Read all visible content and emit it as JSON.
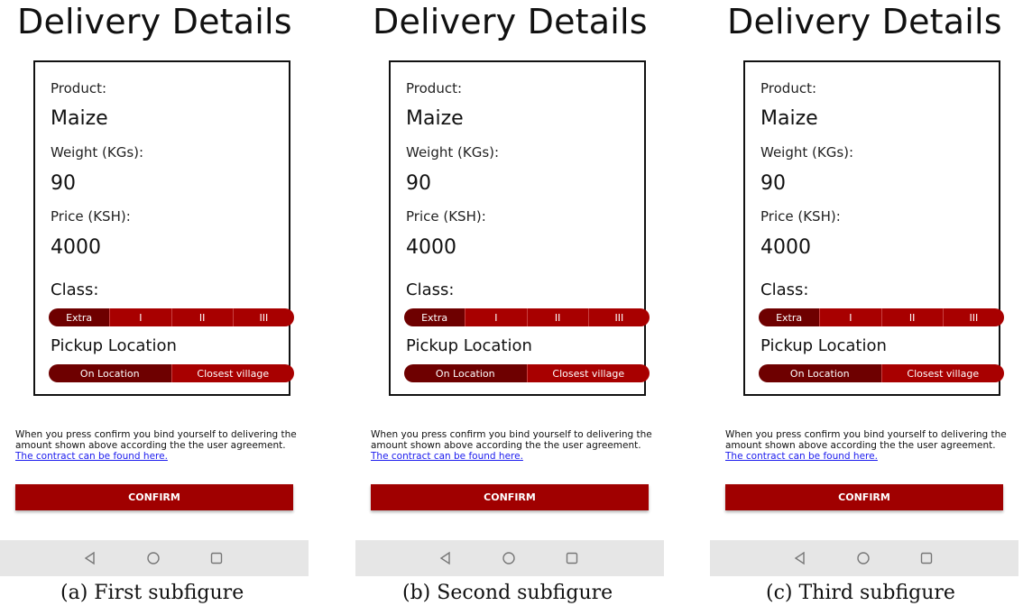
{
  "screens": [
    {
      "title": "Delivery Details",
      "product_label": "Product:",
      "product_value": "Maize",
      "weight_label": "Weight (KGs):",
      "weight_value": "90",
      "price_label": "Price (KSH):",
      "price_value": "4000",
      "class_label": "Class:",
      "class_options": [
        "Extra",
        "I",
        "II",
        "III"
      ],
      "class_selected": "Extra",
      "pickup_label": "Pickup Location",
      "pickup_options": [
        "On Location",
        "Closest village"
      ],
      "pickup_selected": "On Location",
      "notice": "When you press confirm you bind yourself to delivering the amount shown above according the the user agreement.",
      "contract_link": "The contract can be found here.",
      "confirm_label": "CONFIRM",
      "caption": "(a) First subfigure"
    },
    {
      "title": "Delivery Details",
      "product_label": "Product:",
      "product_value": "Maize",
      "weight_label": "Weight (KGs):",
      "weight_value": "90",
      "price_label": "Price (KSH):",
      "price_value": "4000",
      "class_label": "Class:",
      "class_options": [
        "Extra",
        "I",
        "II",
        "III"
      ],
      "class_selected": "Extra",
      "pickup_label": "Pickup Location",
      "pickup_options": [
        "On Location",
        "Closest village"
      ],
      "pickup_selected": "On Location",
      "notice": "When you press confirm you bind yourself to delivering the amount shown above according the the user agreement.",
      "contract_link": "The contract can be found here.",
      "confirm_label": "CONFIRM",
      "caption": "(b) Second subfigure"
    },
    {
      "title": "Delivery Details",
      "product_label": "Product:",
      "product_value": "Maize",
      "weight_label": "Weight (KGs):",
      "weight_value": "90",
      "price_label": "Price (KSH):",
      "price_value": "4000",
      "class_label": "Class:",
      "class_options": [
        "Extra",
        "I",
        "II",
        "III"
      ],
      "class_selected": "Extra",
      "pickup_label": "Pickup Location",
      "pickup_options": [
        "On Location",
        "Closest village"
      ],
      "pickup_selected": "On Location",
      "notice": "When you press confirm you bind yourself to delivering the amount shown above according the the user agreement.",
      "contract_link": "The contract can be found here.",
      "confirm_label": "CONFIRM",
      "caption": "(c) Third subfigure"
    }
  ],
  "nav_icons": [
    "back-icon",
    "home-icon",
    "recents-icon"
  ],
  "colors": {
    "accent": "#a80000",
    "selected": "#6e0000",
    "link": "#1a1aee",
    "navbar": "#e6e6e6"
  }
}
